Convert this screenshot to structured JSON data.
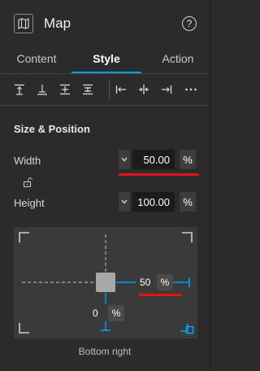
{
  "header": {
    "title": "Map",
    "help_glyph": "?"
  },
  "tabs": [
    {
      "label": "Content",
      "active": false
    },
    {
      "label": "Style",
      "active": true
    },
    {
      "label": "Action",
      "active": false
    }
  ],
  "toolbar": {
    "icons": [
      "align-top-icon",
      "align-vertical-center-icon",
      "align-bottom-icon",
      "distribute-vertical-icon",
      "align-left-icon",
      "align-horizontal-center-icon",
      "align-right-icon",
      "more-icon"
    ]
  },
  "section": {
    "title": "Size & Position"
  },
  "width": {
    "label": "Width",
    "value": "50.00",
    "unit": "%"
  },
  "height": {
    "label": "Height",
    "value": "100.00",
    "unit": "%"
  },
  "anchor": {
    "right_value": "50",
    "right_unit": "%",
    "bottom_value": "0",
    "bottom_unit": "%",
    "caption": "Bottom right"
  },
  "colors": {
    "accent": "#00a0ff",
    "annotation_red": "#e0151b",
    "panel_bg": "#2b2b2b"
  }
}
